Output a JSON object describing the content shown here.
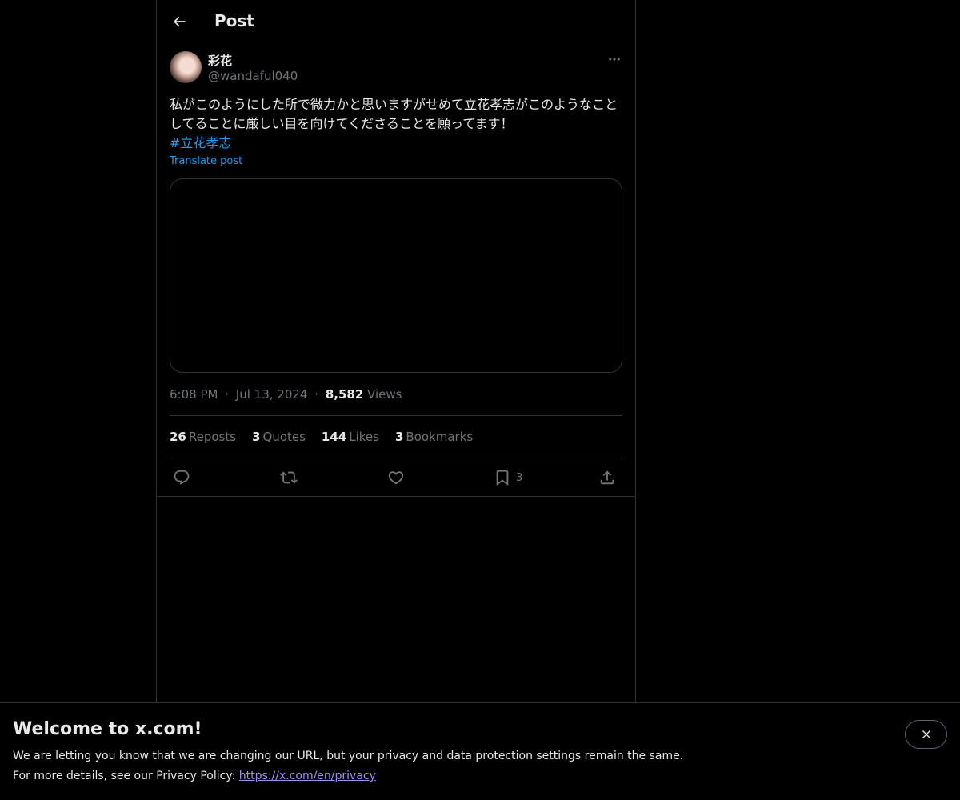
{
  "header": {
    "title": "Post"
  },
  "author": {
    "display_name": "彩花",
    "handle": "@wandaful040"
  },
  "post": {
    "text": "私がこのようにした所で微力かと思いますがせめて立花孝志がこのようなことしてることに厳しい目を向けてくださることを願ってます！",
    "hashtag": "#立花孝志",
    "translate_label": "Translate post"
  },
  "meta": {
    "time": "6:08 PM",
    "separator": "·",
    "date": "Jul 13, 2024",
    "views_count": "8,582",
    "views_label": "Views"
  },
  "stats": {
    "reposts_count": "26",
    "reposts_label": "Reposts",
    "quotes_count": "3",
    "quotes_label": "Quotes",
    "likes_count": "144",
    "likes_label": "Likes",
    "bookmarks_count": "3",
    "bookmarks_label": "Bookmarks"
  },
  "actions": {
    "reply_icon": "reply-icon",
    "repost_icon": "repost-icon",
    "like_icon": "heart-icon",
    "bookmark_icon": "bookmark-icon",
    "bookmark_count": "3",
    "share_icon": "share-icon"
  },
  "banner": {
    "title": "Welcome to x.com!",
    "line1": "We are letting you know that we are changing our URL, but your privacy and data protection settings remain the same.",
    "line2_prefix": "For more details, see our Privacy Policy: ",
    "link_text": "https://x.com/en/privacy"
  },
  "colors": {
    "background": "#000000",
    "text": "#e7e9ea",
    "muted": "#71767b",
    "accent": "#1d9bf0",
    "border": "#2f3336",
    "link": "#a38ffa"
  }
}
